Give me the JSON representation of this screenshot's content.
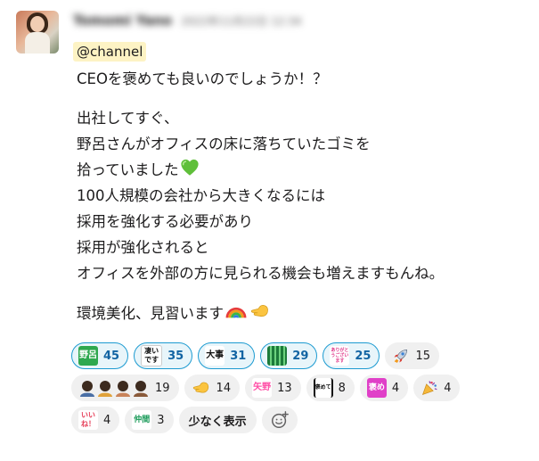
{
  "author": {
    "name": "Tomomi Yano",
    "timestamp": "2022年11月22日 12:34"
  },
  "mention": "@channel",
  "lines": [
    "CEOを褒めても良いのでしょうか！？",
    "",
    "出社してすぐ、",
    "野呂さんがオフィスの床に落ちていたゴミを",
    "拾っていました",
    "100人規模の会社から大きくなるには",
    "採用を強化する必要があり",
    "採用が強化されると",
    "オフィスを外部の方に見られる機会も増えますもんね。",
    "",
    "環境美化、見習います"
  ],
  "colors": {
    "mention_bg": "#fdf3c4",
    "reacted_border": "#1d9bd1",
    "reacted_bg": "#e8f5fa",
    "reacted_text": "#1264a3",
    "pill_bg": "#f0f0f0"
  },
  "reactions": [
    {
      "icon": "stamp-noro",
      "stamp_text": "野呂",
      "count": "45",
      "mine": true
    },
    {
      "icon": "stamp-sugoi-desu",
      "stamp_text": "凄いです",
      "count": "35",
      "mine": true
    },
    {
      "icon": "stamp-daiji",
      "stamp_text": "大事",
      "count": "31",
      "mine": true
    },
    {
      "icon": "stamp-green",
      "stamp_text": "",
      "count": "29",
      "mine": true
    },
    {
      "icon": "stamp-arigatou",
      "stamp_text": "ありがとうございます",
      "count": "25",
      "mine": true
    },
    {
      "icon": "rocket-icon",
      "count": "15",
      "mine": false
    },
    {
      "icon": "bowing-people-icon",
      "count": "19",
      "mine": false
    },
    {
      "icon": "pointing-hand-icon",
      "count": "14",
      "mine": false
    },
    {
      "icon": "stamp-yagami",
      "stamp_text": "矢野",
      "count": "13",
      "mine": false
    },
    {
      "icon": "stamp-homete",
      "stamp_text": "褒めて",
      "count": "8",
      "mine": false
    },
    {
      "icon": "stamp-home",
      "stamp_text": "褒め",
      "count": "4",
      "mine": false
    },
    {
      "icon": "party-popper-icon",
      "count": "4",
      "mine": false
    },
    {
      "icon": "stamp-iine",
      "stamp_text": "いいね！",
      "count": "4",
      "mine": false
    },
    {
      "icon": "stamp-nakama",
      "stamp_text": "仲間",
      "count": "3",
      "mine": false
    }
  ],
  "show_less_label": "少なく表示"
}
